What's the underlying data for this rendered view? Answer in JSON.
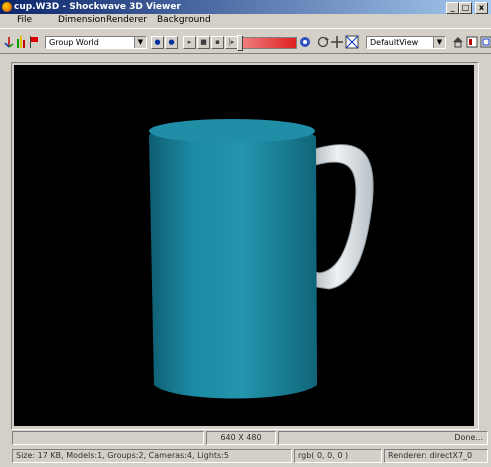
{
  "window": {
    "title": "cup.W3D - Shockwave 3D Viewer",
    "min_label": "_",
    "max_label": "□",
    "close_label": "x"
  },
  "menu": {
    "items": [
      "File",
      "Dimension",
      "Renderer",
      "Background"
    ]
  },
  "toolbar": {
    "group_value": "Group World",
    "view_value": "DefaultView",
    "slider_level": 0.0
  },
  "status": {
    "dimensions": "640 X 480",
    "done": "Done...",
    "info": "Size: 17 KB, Models:1, Groups:2, Cameras:4, Lights:5",
    "rgb": "rgb( 0, 0, 0 )",
    "renderer": "Renderer:  directX7_0"
  },
  "colors": {
    "mug_body": "#1e8aa0",
    "mug_handle": "#dfe3e6",
    "viewport_bg": "#000000"
  }
}
